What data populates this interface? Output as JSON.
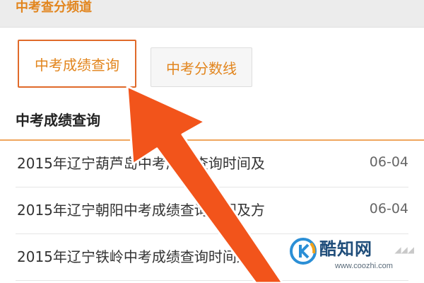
{
  "header": {
    "title": "中考查分频道"
  },
  "tabs": [
    {
      "label": "中考成绩查询",
      "active": true
    },
    {
      "label": "中考分数线",
      "active": false
    }
  ],
  "section": {
    "heading": "中考成绩查询"
  },
  "news": [
    {
      "title": "2015年辽宁葫芦岛中考成绩查询时间及",
      "date": "06-04"
    },
    {
      "title": "2015年辽宁朝阳中考成绩查询时间及方",
      "date": "06-04"
    },
    {
      "title": "2015年辽宁铁岭中考成绩查询时间及",
      "date": ""
    }
  ],
  "watermark": {
    "brand": "酷知网",
    "url": "www.coozhi.com"
  },
  "colors": {
    "accent": "#e2851d",
    "arrow": "#f2541b",
    "divider": "#f0a65e",
    "watermark_brand": "#1f4d7a"
  }
}
